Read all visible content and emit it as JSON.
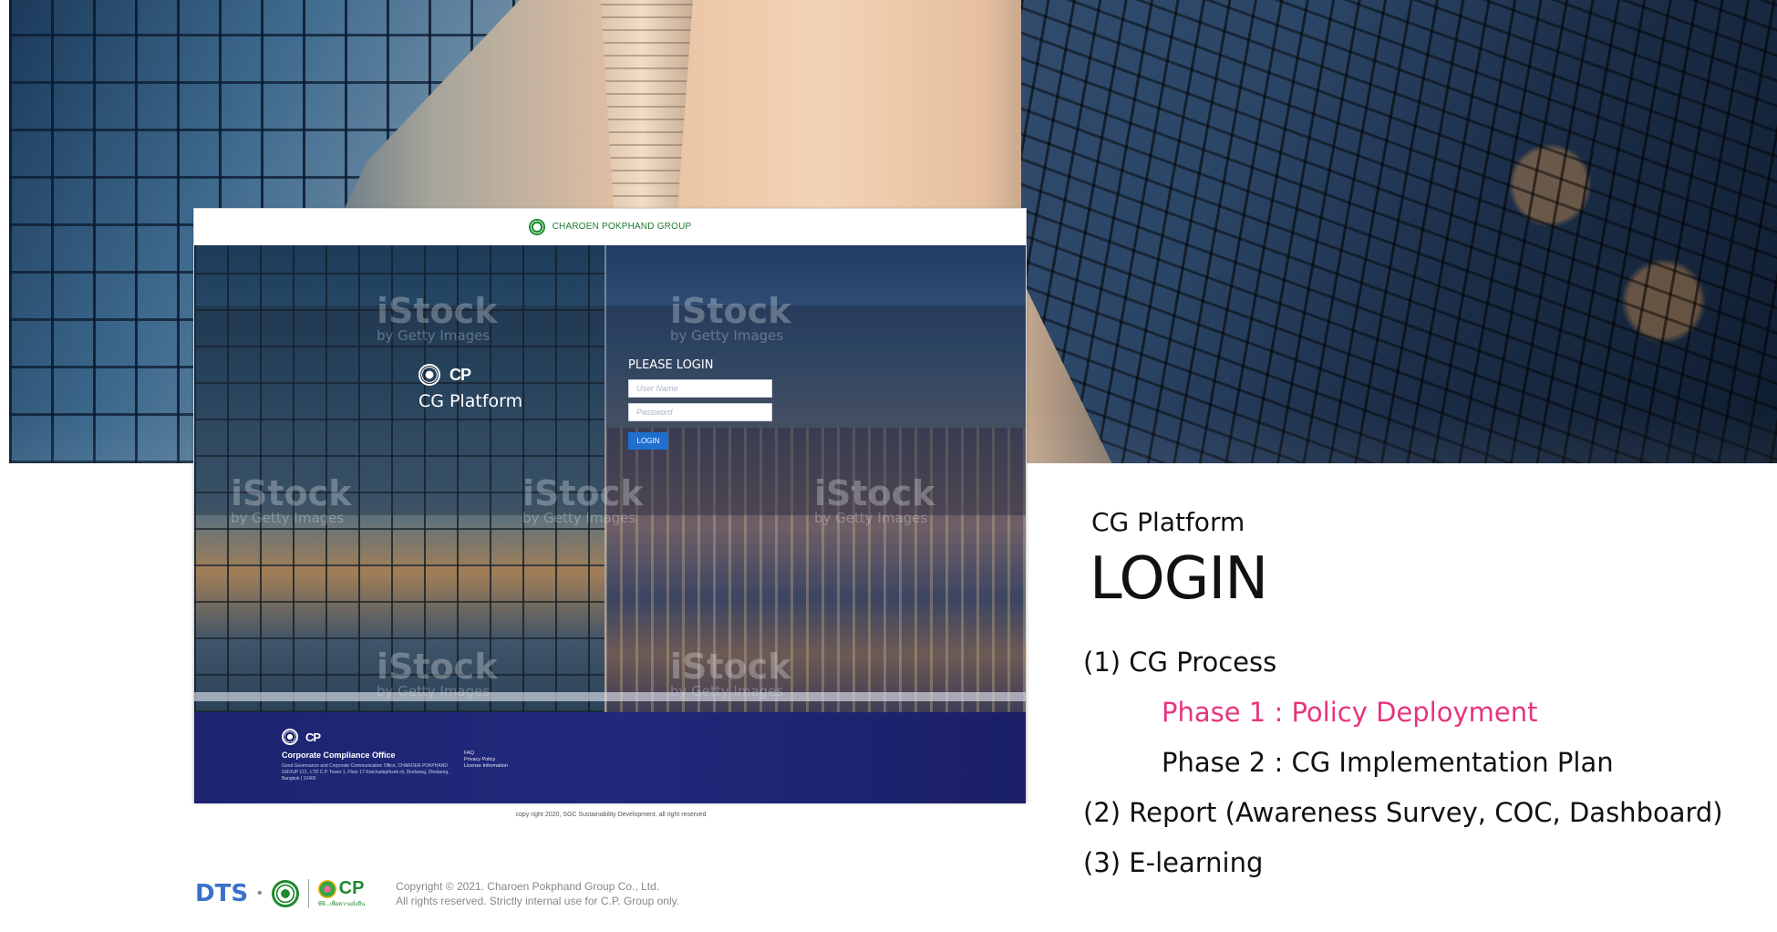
{
  "embedded_login": {
    "header_brand": "CHAROEN POKPHAND GROUP",
    "platform_title": "CG Platform",
    "cp_mark": "CP",
    "form_title": "PLEASE LOGIN",
    "username_placeholder": "User Name",
    "password_placeholder": "Password",
    "login_button": "LOGIN",
    "watermark": "iStock",
    "watermark_sub": "by Getty Images",
    "footer": {
      "cp_mark": "CP",
      "office": "Corporate Compliance Office",
      "address": "Good Governance and Corporate Communication Office, CHAROEN POKPHAND GROUP CO., LTD C.P. Tower 1, Floor 17 Ratchadaphisek rd, Dindaeng, Dindaeng, Bangkok | 10400",
      "links": [
        "FAQ",
        "Privacy Policy",
        "License Information"
      ]
    },
    "copyright": "copy right 2020, SGC Sustainability Development, all right reserved"
  },
  "side": {
    "subtitle": "CG Platform",
    "title": "LOGIN",
    "items": [
      "(1) CG Process",
      "Phase 1 : Policy Deployment",
      "Phase 2 : CG Implementation Plan",
      "(2) Report (Awareness Survey, COC, Dashboard)",
      "(3) E-learning"
    ],
    "highlight_color": "#e6357f"
  },
  "footer": {
    "dts": "DTS",
    "separator": "•",
    "cp_mark": "CP",
    "cp_thai": "ซีพี...เพื่อความยั่งยืน",
    "line1": "Copyright © 2021. Charoen Pokphand Group Co., Ltd.",
    "line2": "All rights reserved. Strictly internal use for C.P. Group only."
  }
}
